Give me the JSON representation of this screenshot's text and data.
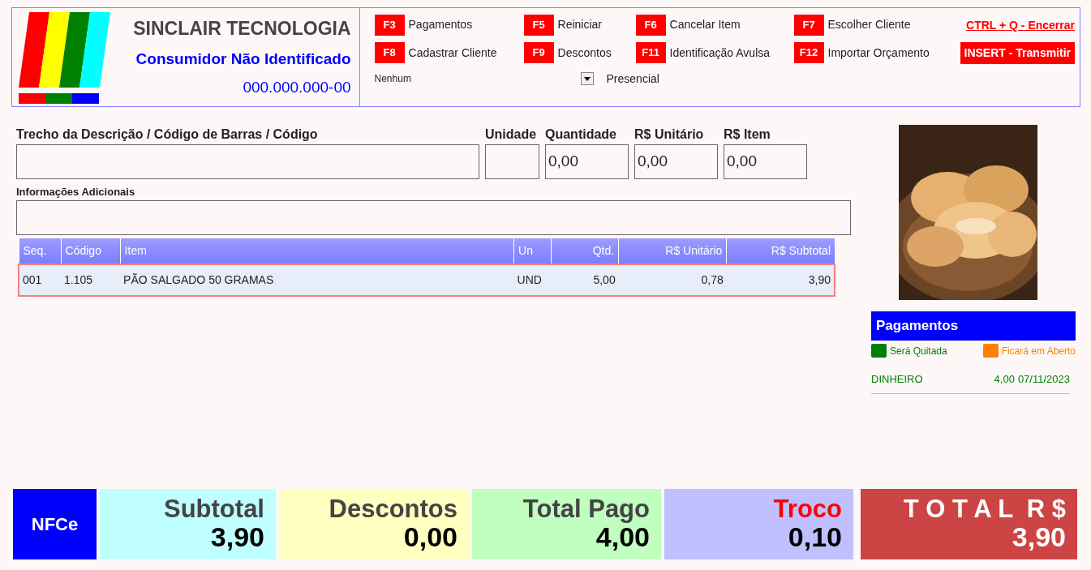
{
  "header": {
    "company": "SINCLAIR TECNOLOGIA",
    "customer": "Consumidor Não Identificado",
    "document": "000.000.000-00"
  },
  "shortcuts": [
    {
      "key": "F3",
      "label": "Pagamentos"
    },
    {
      "key": "F5",
      "label": "Reiniciar"
    },
    {
      "key": "F6",
      "label": "Cancelar Item"
    },
    {
      "key": "F7",
      "label": "Escolher Cliente"
    },
    {
      "key": "F8",
      "label": "Cadastrar Cliente"
    },
    {
      "key": "F9",
      "label": "Descontos"
    },
    {
      "key": "F11",
      "label": "Identificação Avulsa"
    },
    {
      "key": "F12",
      "label": "Importar Orçamento"
    }
  ],
  "actions": [
    {
      "label": "CTRL + Q - Encerrar",
      "kind": "link"
    },
    {
      "label": "INSERT - Transmitir",
      "kind": "button"
    }
  ],
  "seller_select": {
    "value": "Nenhum"
  },
  "mode": "Presencial",
  "fields": [
    {
      "label": "Trecho da Descrição / Código de Barras / Código",
      "kind": "wide"
    },
    {
      "label": "Unidade",
      "kind": "small"
    },
    {
      "label": "Quantidade",
      "value": "0,00",
      "kind": "number"
    },
    {
      "label": "R$ Unitário",
      "value": "0,00",
      "kind": "number"
    },
    {
      "label": "R$ Item",
      "value": "0,00",
      "kind": "number"
    }
  ],
  "additional_info": {
    "label": "Informações Adicionais"
  },
  "table": {
    "columns": [
      "Seq.",
      "Código",
      "Item",
      "Un",
      "Qtd.",
      "R$ Unitário",
      "R$ Subtotal"
    ],
    "rows": [
      {
        "cells": [
          "001",
          "1.105",
          "PÃO SALGADO 50 GRAMAS",
          "UND",
          "5,00",
          "0,78",
          "3,90"
        ],
        "selected": true
      }
    ]
  },
  "payments": {
    "title": "Pagamentos",
    "legend": [
      {
        "label": "Será Quitada",
        "color": "#008000"
      },
      {
        "label": "Ficará em Aberto",
        "color": "#ff8000"
      }
    ],
    "entries": [
      {
        "method": "DINHEIRO",
        "amount": "4,00",
        "date": "07/11/2023",
        "color": "#008000"
      }
    ]
  },
  "totals": [
    {
      "kind": "nfce",
      "value": "NFCe"
    },
    {
      "kind": "subtotal",
      "label": "Subtotal",
      "value": "3,90"
    },
    {
      "kind": "discount",
      "label": "Descontos",
      "value": "0,00"
    },
    {
      "kind": "paid",
      "label": "Total Pago",
      "value": "4,00"
    },
    {
      "kind": "change",
      "label": "Troco",
      "value": "0,10"
    },
    {
      "kind": "total",
      "label": "T O T A L  R $",
      "value": "3,90"
    }
  ]
}
